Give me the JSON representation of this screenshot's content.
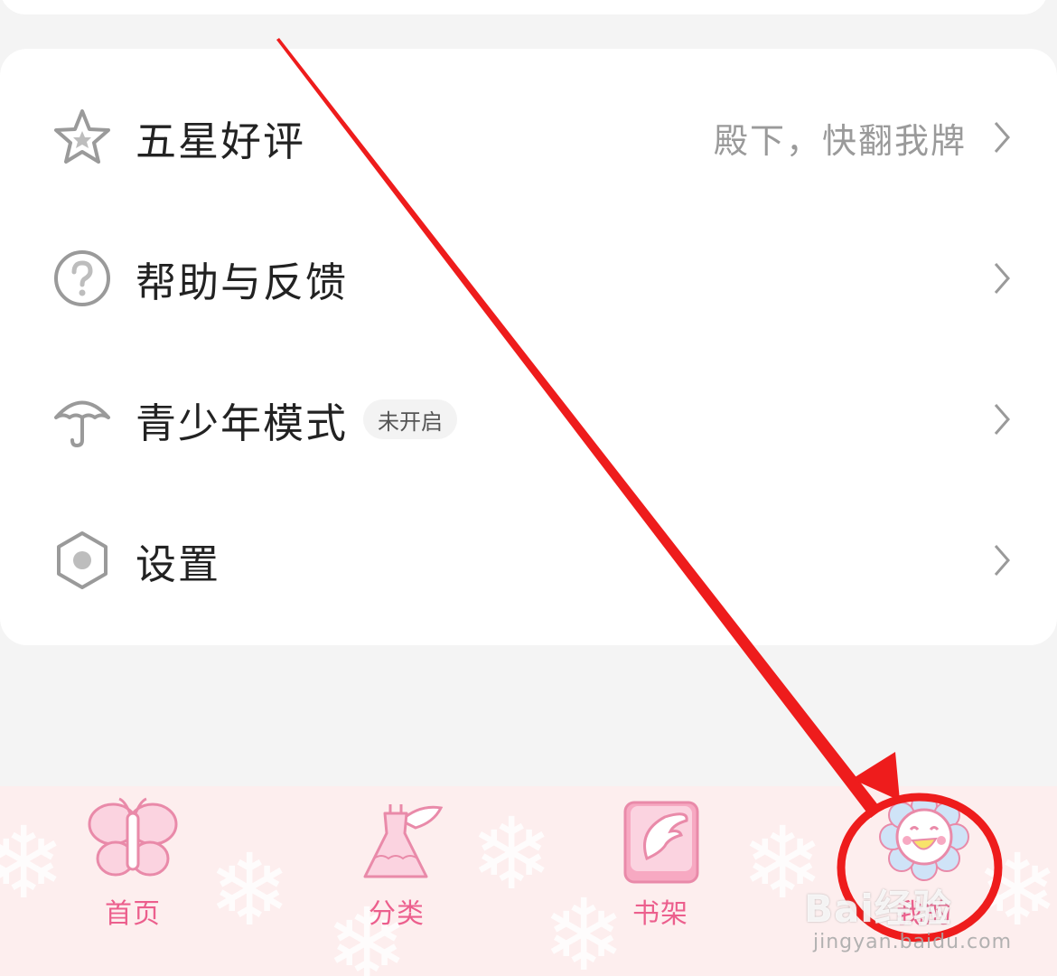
{
  "menu": {
    "items": [
      {
        "label": "五星好评",
        "right_text": "殿下，快翻我牌",
        "icon": "star-icon"
      },
      {
        "label": "帮助与反馈",
        "right_text": "",
        "icon": "help-icon"
      },
      {
        "label": "青少年模式",
        "badge": "未开启",
        "right_text": "",
        "icon": "umbrella-icon"
      },
      {
        "label": "设置",
        "right_text": "",
        "icon": "settings-icon"
      }
    ]
  },
  "tabbar": {
    "tabs": [
      {
        "label": "首页",
        "icon": "butterfly-icon"
      },
      {
        "label": "分类",
        "icon": "dress-icon"
      },
      {
        "label": "书架",
        "icon": "book-icon"
      },
      {
        "label": "我的",
        "icon": "flower-face-icon",
        "active": true
      }
    ]
  },
  "annotation": {
    "color": "#ee1c1c"
  },
  "watermark": {
    "brand": "Bai经验",
    "url": "jingyan.baidu.com"
  }
}
